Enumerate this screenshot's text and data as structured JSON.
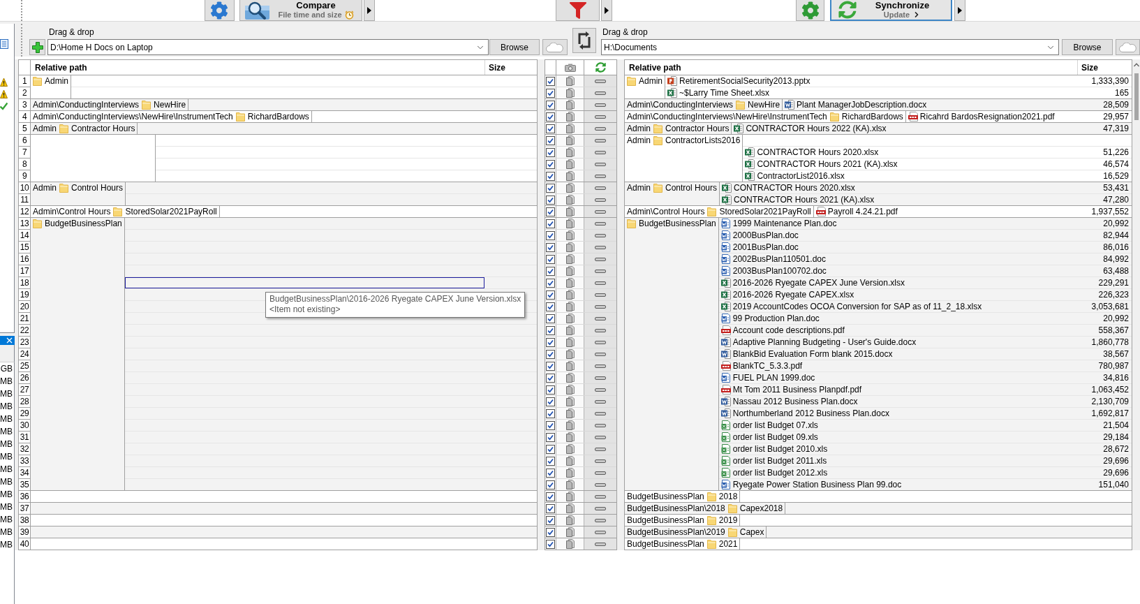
{
  "toolbar": {
    "compare": {
      "title": "Compare",
      "subtitle": "File time and size"
    },
    "synchronize": {
      "title": "Synchronize",
      "subtitle": "Update"
    }
  },
  "left_folder": {
    "label": "Drag & drop",
    "value": "D:\\Home H Docs on Laptop",
    "browse": "Browse"
  },
  "right_folder": {
    "label": "Drag & drop",
    "value": "H:\\Documents",
    "browse": "Browse"
  },
  "side_panel": {
    "status_icons": [
      {
        "kind": "warning"
      },
      {
        "kind": "warning"
      },
      {
        "kind": "ok"
      }
    ],
    "column_values": [
      "GB",
      "MB",
      "MB",
      "MB",
      "MB",
      "MB",
      "MB",
      "MB",
      "MB",
      "MB",
      "MB",
      "MB",
      "MB",
      "MB",
      "MB"
    ]
  },
  "left_grid": {
    "columns": [
      "Relative path",
      "Size"
    ]
  },
  "right_grid": {
    "columns": [
      "Relative path",
      "Size"
    ]
  },
  "groups": [
    {
      "left": {
        "folder": "Admin"
      },
      "right": {
        "folder": "Admin"
      },
      "rows": [
        {
          "number": "1",
          "checked": true,
          "category": {
            "kind": "right_only"
          },
          "action": {
            "kind": "none"
          },
          "left_highlighted": false,
          "right_file": {
            "kind": "pptx",
            "name": "RetirementSocialSecurity2013.pptx",
            "size": "1,333,390"
          }
        },
        {
          "number": "2",
          "checked": true,
          "category": {
            "kind": "right_only"
          },
          "action": {
            "kind": "none"
          },
          "left_highlighted": false,
          "right_file": {
            "kind": "xlsx",
            "name": "~$Larry Time Sheet.xlsx",
            "size": "165"
          }
        }
      ]
    },
    {
      "left": {
        "path": "Admin\\ConductingInterviews",
        "folder": "NewHire"
      },
      "right": {
        "path": "Admin\\ConductingInterviews",
        "folder": "NewHire"
      },
      "rows": [
        {
          "number": "3",
          "checked": true,
          "category": {
            "kind": "right_only"
          },
          "action": {
            "kind": "none"
          },
          "left_highlighted": false,
          "right_file": {
            "kind": "docx",
            "name": "Plant ManagerJobDescription.docx",
            "size": "28,509"
          }
        }
      ]
    },
    {
      "left": {
        "path": "Admin\\ConductingInterviews\\NewHire\\InstrumentTech",
        "folder": "RichardBardows"
      },
      "right": {
        "path": "Admin\\ConductingInterviews\\NewHire\\InstrumentTech",
        "folder": "RichardBardows"
      },
      "rows": [
        {
          "number": "4",
          "checked": true,
          "category": {
            "kind": "right_only"
          },
          "action": {
            "kind": "none"
          },
          "left_highlighted": false,
          "right_file": {
            "kind": "pdf",
            "name": "Ricahrd BardosResignation2021.pdf",
            "size": "29,957"
          }
        }
      ]
    },
    {
      "left": {
        "path": "Admin",
        "folder": "Contractor Hours"
      },
      "right": {
        "path": "Admin",
        "folder": "Contractor Hours"
      },
      "rows": [
        {
          "number": "5",
          "checked": true,
          "category": {
            "kind": "right_only"
          },
          "action": {
            "kind": "none"
          },
          "left_highlighted": false,
          "right_file": {
            "kind": "xlsx",
            "name": "CONTRACTOR Hours 2022 (KA).xlsx",
            "size": "47,319"
          }
        }
      ]
    },
    {
      "right": {
        "path": "Admin",
        "folder": "ContractorLists2016"
      },
      "rows": [
        {
          "number": "6",
          "checked": true,
          "category": {
            "kind": "right_only"
          },
          "action": {
            "kind": "none"
          },
          "left_highlighted": false
        },
        {
          "number": "7",
          "checked": true,
          "category": {
            "kind": "right_only"
          },
          "action": {
            "kind": "none"
          },
          "left_highlighted": false,
          "right_file": {
            "kind": "xlsx",
            "name": "CONTRACTOR Hours 2020.xlsx",
            "size": "51,226"
          }
        },
        {
          "number": "8",
          "checked": true,
          "category": {
            "kind": "right_only"
          },
          "action": {
            "kind": "none"
          },
          "left_highlighted": false,
          "right_file": {
            "kind": "xlsx",
            "name": "CONTRACTOR Hours 2021 (KA).xlsx",
            "size": "46,574"
          }
        },
        {
          "number": "9",
          "checked": true,
          "category": {
            "kind": "right_only"
          },
          "action": {
            "kind": "none"
          },
          "left_highlighted": false,
          "right_file": {
            "kind": "xlsx",
            "name": "ContractorList2016.xlsx",
            "size": "16,529"
          }
        }
      ]
    },
    {
      "left": {
        "path": "Admin",
        "folder": "Control Hours"
      },
      "right": {
        "path": "Admin",
        "folder": "Control Hours"
      },
      "rows": [
        {
          "number": "10",
          "checked": true,
          "category": {
            "kind": "right_only"
          },
          "action": {
            "kind": "none"
          },
          "left_highlighted": false,
          "right_file": {
            "kind": "xlsx",
            "name": "CONTRACTOR Hours 2020.xlsx",
            "size": "53,431"
          }
        },
        {
          "number": "11",
          "checked": true,
          "category": {
            "kind": "right_only"
          },
          "action": {
            "kind": "none"
          },
          "left_highlighted": false,
          "right_file": {
            "kind": "xlsx",
            "name": "CONTRACTOR Hours 2021 (KA).xlsx",
            "size": "47,280"
          }
        }
      ]
    },
    {
      "left": {
        "path": "Admin\\Control Hours",
        "folder": "StoredSolar2021PayRoll"
      },
      "right": {
        "path": "Admin\\Control Hours",
        "folder": "StoredSolar2021PayRoll"
      },
      "rows": [
        {
          "number": "12",
          "checked": true,
          "category": {
            "kind": "right_only"
          },
          "action": {
            "kind": "none"
          },
          "left_highlighted": false,
          "right_file": {
            "kind": "pdf",
            "name": "Payroll 4.24.21.pdf",
            "size": "1,937,552"
          }
        }
      ]
    },
    {
      "left": {
        "folder": "BudgetBusinessPlan"
      },
      "right": {
        "folder": "BudgetBusinessPlan"
      },
      "rows": [
        {
          "number": "13",
          "checked": true,
          "category": {
            "kind": "right_only"
          },
          "action": {
            "kind": "none"
          },
          "left_highlighted": false,
          "right_file": {
            "kind": "doc",
            "name": "1999 Maintenance Plan.doc",
            "size": "20,992"
          }
        },
        {
          "number": "14",
          "checked": true,
          "category": {
            "kind": "right_only"
          },
          "action": {
            "kind": "none"
          },
          "left_highlighted": false,
          "right_file": {
            "kind": "doc",
            "name": "2000BusPlan.doc",
            "size": "82,944"
          }
        },
        {
          "number": "15",
          "checked": true,
          "category": {
            "kind": "right_only"
          },
          "action": {
            "kind": "none"
          },
          "left_highlighted": false,
          "right_file": {
            "kind": "doc",
            "name": "2001BusPlan.doc",
            "size": "86,016"
          }
        },
        {
          "number": "16",
          "checked": true,
          "category": {
            "kind": "right_only"
          },
          "action": {
            "kind": "none"
          },
          "left_highlighted": false,
          "right_file": {
            "kind": "doc",
            "name": "2002BusPlan110501.doc",
            "size": "84,992"
          }
        },
        {
          "number": "17",
          "checked": true,
          "category": {
            "kind": "right_only"
          },
          "action": {
            "kind": "none"
          },
          "left_highlighted": false,
          "right_file": {
            "kind": "doc",
            "name": "2003BusPlan100702.doc",
            "size": "63,488"
          }
        },
        {
          "number": "18",
          "checked": true,
          "category": {
            "kind": "right_only"
          },
          "action": {
            "kind": "none"
          },
          "left_highlighted": true,
          "right_file": {
            "kind": "xlsx",
            "name": "2016-2026 Ryegate CAPEX June Version.xlsx",
            "size": "229,291"
          }
        },
        {
          "number": "19",
          "checked": true,
          "category": {
            "kind": "right_only"
          },
          "action": {
            "kind": "none"
          },
          "left_highlighted": false,
          "right_file": {
            "kind": "xlsx",
            "name": "2016-2026 Ryegate CAPEX.xlsx",
            "size": "226,323"
          }
        },
        {
          "number": "20",
          "checked": true,
          "category": {
            "kind": "right_only"
          },
          "action": {
            "kind": "none"
          },
          "left_highlighted": false,
          "right_file": {
            "kind": "xlsx",
            "name": "2019 AccountCodes OCOA Conversion for SAP as of 11_2_18.xlsx",
            "size": "3,053,681"
          }
        },
        {
          "number": "21",
          "checked": true,
          "category": {
            "kind": "right_only"
          },
          "action": {
            "kind": "none"
          },
          "left_highlighted": false,
          "right_file": {
            "kind": "doc",
            "name": "99 Production Plan.doc",
            "size": "20,992"
          }
        },
        {
          "number": "22",
          "checked": true,
          "category": {
            "kind": "right_only"
          },
          "action": {
            "kind": "none"
          },
          "left_highlighted": false,
          "right_file": {
            "kind": "pdf",
            "name": "Account code descriptions.pdf",
            "size": "558,367"
          }
        },
        {
          "number": "23",
          "checked": true,
          "category": {
            "kind": "right_only"
          },
          "action": {
            "kind": "none"
          },
          "left_highlighted": false,
          "right_file": {
            "kind": "docx",
            "name": "Adaptive Planning Budgeting - User's Guide.docx",
            "size": "1,860,778"
          }
        },
        {
          "number": "24",
          "checked": true,
          "category": {
            "kind": "right_only"
          },
          "action": {
            "kind": "none"
          },
          "left_highlighted": false,
          "right_file": {
            "kind": "docx",
            "name": "BlankBid Evaluation Form blank 2015.docx",
            "size": "38,567"
          }
        },
        {
          "number": "25",
          "checked": true,
          "category": {
            "kind": "right_only"
          },
          "action": {
            "kind": "none"
          },
          "left_highlighted": false,
          "right_file": {
            "kind": "pdf",
            "name": "BlankTC_5.3.3.pdf",
            "size": "780,987"
          }
        },
        {
          "number": "26",
          "checked": true,
          "category": {
            "kind": "right_only"
          },
          "action": {
            "kind": "none"
          },
          "left_highlighted": false,
          "right_file": {
            "kind": "doc",
            "name": "FUEL PLAN 1999.doc",
            "size": "34,816"
          }
        },
        {
          "number": "27",
          "checked": true,
          "category": {
            "kind": "right_only"
          },
          "action": {
            "kind": "none"
          },
          "left_highlighted": false,
          "right_file": {
            "kind": "pdf",
            "name": "Mt Tom 2011 Business Planpdf.pdf",
            "size": "1,063,452"
          }
        },
        {
          "number": "28",
          "checked": true,
          "category": {
            "kind": "right_only"
          },
          "action": {
            "kind": "none"
          },
          "left_highlighted": false,
          "right_file": {
            "kind": "docx",
            "name": "Nassau 2012 Business Plan.docx",
            "size": "2,130,709"
          }
        },
        {
          "number": "29",
          "checked": true,
          "category": {
            "kind": "right_only"
          },
          "action": {
            "kind": "none"
          },
          "left_highlighted": false,
          "right_file": {
            "kind": "docx",
            "name": "Northumberland 2012 Business Plan.docx",
            "size": "1,692,817"
          }
        },
        {
          "number": "30",
          "checked": true,
          "category": {
            "kind": "right_only"
          },
          "action": {
            "kind": "none"
          },
          "left_highlighted": false,
          "right_file": {
            "kind": "xls",
            "name": "order list Budget 07.xls",
            "size": "21,504"
          }
        },
        {
          "number": "31",
          "checked": true,
          "category": {
            "kind": "right_only"
          },
          "action": {
            "kind": "none"
          },
          "left_highlighted": false,
          "right_file": {
            "kind": "xls",
            "name": "order list Budget 09.xls",
            "size": "29,184"
          }
        },
        {
          "number": "32",
          "checked": true,
          "category": {
            "kind": "right_only"
          },
          "action": {
            "kind": "none"
          },
          "left_highlighted": false,
          "right_file": {
            "kind": "xls",
            "name": "order list Budget 2010.xls",
            "size": "28,672"
          }
        },
        {
          "number": "33",
          "checked": true,
          "category": {
            "kind": "right_only"
          },
          "action": {
            "kind": "none"
          },
          "left_highlighted": false,
          "right_file": {
            "kind": "xls",
            "name": "order list Budget 2011.xls",
            "size": "29,696"
          }
        },
        {
          "number": "34",
          "checked": true,
          "category": {
            "kind": "right_only"
          },
          "action": {
            "kind": "none"
          },
          "left_highlighted": false,
          "right_file": {
            "kind": "xls",
            "name": "order list Budget 2012.xls",
            "size": "29,696"
          }
        },
        {
          "number": "35",
          "checked": true,
          "category": {
            "kind": "right_only"
          },
          "action": {
            "kind": "none"
          },
          "left_highlighted": false,
          "right_file": {
            "kind": "doc",
            "name": "Ryegate Power Station Business Plan 99.doc",
            "size": "151,040"
          }
        }
      ]
    },
    {
      "right": {
        "path": "BudgetBusinessPlan",
        "folder": "2018"
      },
      "rows": [
        {
          "number": "36",
          "checked": true,
          "category": {
            "kind": "right_only"
          },
          "action": {
            "kind": "none"
          },
          "left_highlighted": false
        }
      ]
    },
    {
      "right": {
        "path": "BudgetBusinessPlan\\2018",
        "folder": "Capex2018"
      },
      "rows": [
        {
          "number": "37",
          "checked": true,
          "category": {
            "kind": "right_only"
          },
          "action": {
            "kind": "none"
          },
          "left_highlighted": false
        }
      ]
    },
    {
      "right": {
        "path": "BudgetBusinessPlan",
        "folder": "2019"
      },
      "rows": [
        {
          "number": "38",
          "checked": true,
          "category": {
            "kind": "right_only"
          },
          "action": {
            "kind": "none"
          },
          "left_highlighted": false
        }
      ]
    },
    {
      "right": {
        "path": "BudgetBusinessPlan\\2019",
        "folder": "Capex"
      },
      "rows": [
        {
          "number": "39",
          "checked": true,
          "category": {
            "kind": "right_only"
          },
          "action": {
            "kind": "none"
          },
          "left_highlighted": false
        }
      ]
    },
    {
      "right": {
        "path": "BudgetBusinessPlan",
        "folder": "2021"
      },
      "rows": [
        {
          "number": "40",
          "checked": true,
          "category": {
            "kind": "right_only"
          },
          "action": {
            "kind": "none"
          },
          "left_highlighted": false
        }
      ]
    }
  ],
  "tooltip": {
    "lines": [
      "BudgetBusinessPlan\\2016-2026 Ryegate CAPEX June Version.xlsx",
      "<Item not existing>"
    ]
  }
}
